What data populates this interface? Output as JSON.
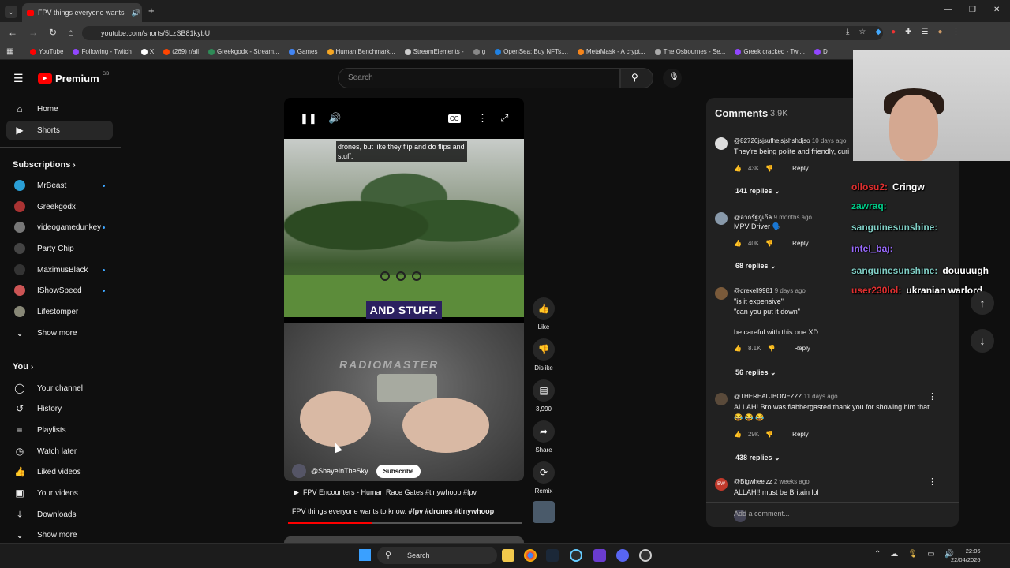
{
  "browser": {
    "tab_title": "FPV things everyone wants",
    "url": "youtube.com/shorts/5LzSB81kybU",
    "bookmarks": [
      {
        "label": "YouTube",
        "color": "#ff0000"
      },
      {
        "label": "Following - Twitch",
        "color": "#9146ff"
      },
      {
        "label": "X",
        "color": "#ffffff"
      },
      {
        "label": "(269) r/all",
        "color": "#ff4500"
      },
      {
        "label": "Greekgodx - Stream...",
        "color": "#2e8b57"
      },
      {
        "label": "Games",
        "color": "#4285f4"
      },
      {
        "label": "Human Benchmark...",
        "color": "#f5a623"
      },
      {
        "label": "StreamElements -",
        "color": "#cccccc"
      },
      {
        "label": "g",
        "color": "#888888"
      },
      {
        "label": "OpenSea: Buy NFTs,...",
        "color": "#2081e2"
      },
      {
        "label": "MetaMask - A crypt...",
        "color": "#f6851b"
      },
      {
        "label": "The Osbournes - Se...",
        "color": "#aaaaaa"
      },
      {
        "label": "Greek cracked - Twi...",
        "color": "#9146ff"
      },
      {
        "label": "D",
        "color": "#9146ff"
      }
    ]
  },
  "header": {
    "logo": "Premium",
    "logo_region": "GB",
    "search_placeholder": "Search"
  },
  "sidebar": {
    "main": [
      {
        "label": "Home",
        "icon": "home-icon"
      },
      {
        "label": "Shorts",
        "icon": "shorts-icon"
      }
    ],
    "subscriptions_title": "Subscriptions",
    "subscriptions": [
      {
        "label": "MrBeast",
        "color": "#2a9fd6",
        "dot": true
      },
      {
        "label": "Greekgodx",
        "color": "#a33",
        "dot": false
      },
      {
        "label": "videogamedunkey",
        "color": "#777",
        "dot": true
      },
      {
        "label": "Party Chip",
        "color": "#333",
        "dot": false
      },
      {
        "label": "MaximusBlack",
        "color": "#222",
        "dot": true
      },
      {
        "label": "IShowSpeed",
        "color": "#c55",
        "dot": true
      },
      {
        "label": "Lifestomper",
        "color": "#887",
        "dot": false
      }
    ],
    "subs_show_more": "Show more",
    "you_title": "You",
    "you": [
      {
        "label": "Your channel",
        "icon": "user-icon"
      },
      {
        "label": "History",
        "icon": "history-icon"
      },
      {
        "label": "Playlists",
        "icon": "playlists-icon"
      },
      {
        "label": "Watch later",
        "icon": "clock-icon"
      },
      {
        "label": "Liked videos",
        "icon": "thumb-up-icon"
      },
      {
        "label": "Your videos",
        "icon": "video-icon"
      },
      {
        "label": "Downloads",
        "icon": "download-icon"
      }
    ],
    "you_show_more": "Show more"
  },
  "video": {
    "caption": "drones, but like they flip and do flips and stuff.",
    "overlay_text": "AND STUFF.",
    "brand": "RADIOMASTER",
    "channel": "@ShayeInTheSky",
    "subscribe": "Subscribe",
    "sound": "FPV Encounters - Human Race Gates #tinywhoop #fpv",
    "title": "FPV things everyone wants to know.",
    "title_tags": "#fpv #drones #tinywhoop",
    "progress": 0.36
  },
  "actions": {
    "like": "Like",
    "dislike": "Dislike",
    "comments": "3,990",
    "share": "Share",
    "remix": "Remix"
  },
  "comments": {
    "title": "Comments",
    "count": "3.9K",
    "items": [
      {
        "handle": "@82726jsjsufhejsjshshdjso",
        "age": "10 days ago",
        "lines": [
          "They're being polite and friendly, curi"
        ],
        "likes": "43K",
        "replies": "141 replies",
        "color": "#ddd"
      },
      {
        "handle": "@อากรัฐกูเก้ล",
        "age": "9 months ago",
        "lines": [
          "MPV Driver 🗣️"
        ],
        "likes": "40K",
        "replies": "68 replies",
        "color": "#8899aa"
      },
      {
        "handle": "@drexell9981",
        "age": "9 days ago",
        "lines": [
          "\"is it expensive\"",
          "\"can you put it down\"",
          "",
          "be careful with this one XD"
        ],
        "likes": "8.1K",
        "replies": "56 replies",
        "color": "#7a5a3a"
      },
      {
        "handle": "@THEREALJBONEZZZ",
        "age": "11 days ago",
        "lines": [
          "ALLAH! Bro was flabbergasted thank you for showing him that",
          "😂 😂 😂"
        ],
        "likes": "29K",
        "replies": "438 replies",
        "color": "#5a4a3a"
      },
      {
        "handle": "@Bigwheelzz",
        "age": "2 weeks ago",
        "lines": [
          "ALLAH!! must be Britain lol"
        ],
        "likes": "",
        "replies": "",
        "color": "#c0392b",
        "initials": "BW"
      }
    ],
    "reply": "Reply",
    "add_comment": "Add a comment..."
  },
  "chat": [
    {
      "user": "ollosu2:",
      "user_color": "#e03030",
      "msg": "Cringw"
    },
    {
      "user": "zawraq:",
      "user_color": "#00cc88",
      "msg": ""
    },
    {
      "user": "sanguinesunshine:",
      "user_color": "#80cfc6",
      "msg": ""
    },
    {
      "user": "intel_baj:",
      "user_color": "#9a6bff",
      "msg": ""
    },
    {
      "user": "sanguinesunshine:",
      "user_color": "#80cfc6",
      "msg": "douuuugh"
    },
    {
      "user": "user230lol:",
      "user_color": "#e03030",
      "msg": "ukranian warlord"
    }
  ],
  "taskbar": {
    "search": "Search",
    "time": "22:06",
    "date": "22/04/2026"
  }
}
